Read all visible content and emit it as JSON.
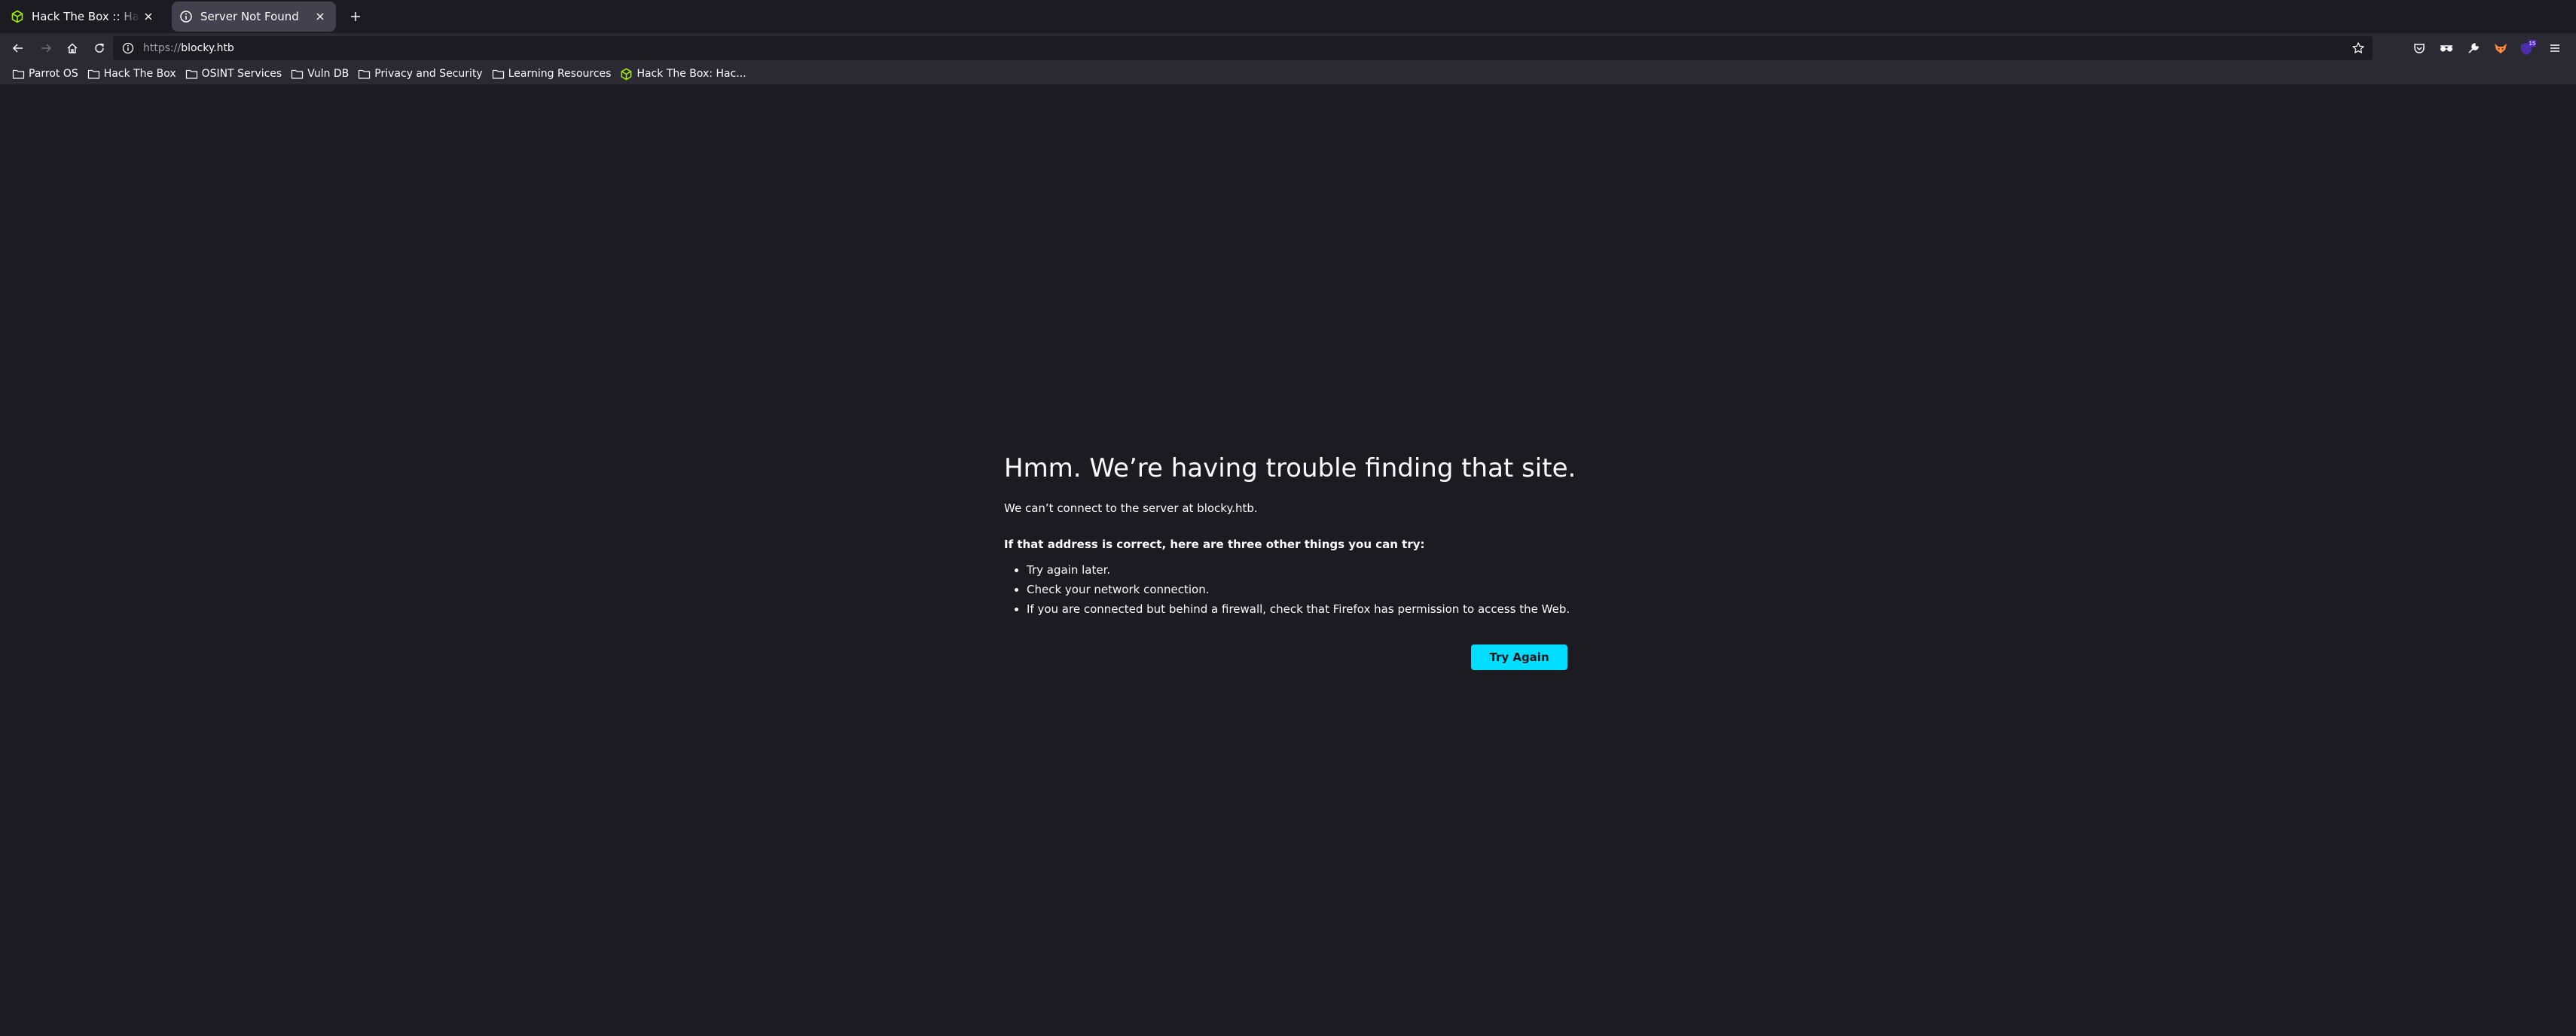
{
  "tabs": [
    {
      "title": "Hack The Box :: Hack The Box",
      "favicon": "htb-cube-icon",
      "active": false
    },
    {
      "title": "Server Not Found",
      "favicon": "info-circle-icon",
      "active": true
    }
  ],
  "navbar": {
    "url_scheme": "https://",
    "url_host": "blocky.htb",
    "extensions_badge": "15"
  },
  "bookmarks": [
    {
      "label": "Parrot OS",
      "icon": "folder-icon"
    },
    {
      "label": "Hack The Box",
      "icon": "folder-icon"
    },
    {
      "label": "OSINT Services",
      "icon": "folder-icon"
    },
    {
      "label": "Vuln DB",
      "icon": "folder-icon"
    },
    {
      "label": "Privacy and Security",
      "icon": "folder-icon"
    },
    {
      "label": "Learning Resources",
      "icon": "folder-icon"
    },
    {
      "label": "Hack The Box: Hac...",
      "icon": "htb-cube-icon"
    }
  ],
  "error": {
    "title": "Hmm. We’re having trouble finding that site.",
    "description": "We can’t connect to the server at blocky.htb.",
    "suggestions_title": "If that address is correct, here are three other things you can try:",
    "suggestions": [
      "Try again later.",
      "Check your network connection.",
      "If you are connected but behind a firewall, check that Firefox has permission to access the Web."
    ],
    "button_label": "Try Again"
  },
  "colors": {
    "page_bg": "#1c1b22",
    "toolbar_bg": "#2b2a33",
    "active_tab_bg": "#42414d",
    "accent": "#00ddff",
    "htb_green": "#9fef00"
  }
}
